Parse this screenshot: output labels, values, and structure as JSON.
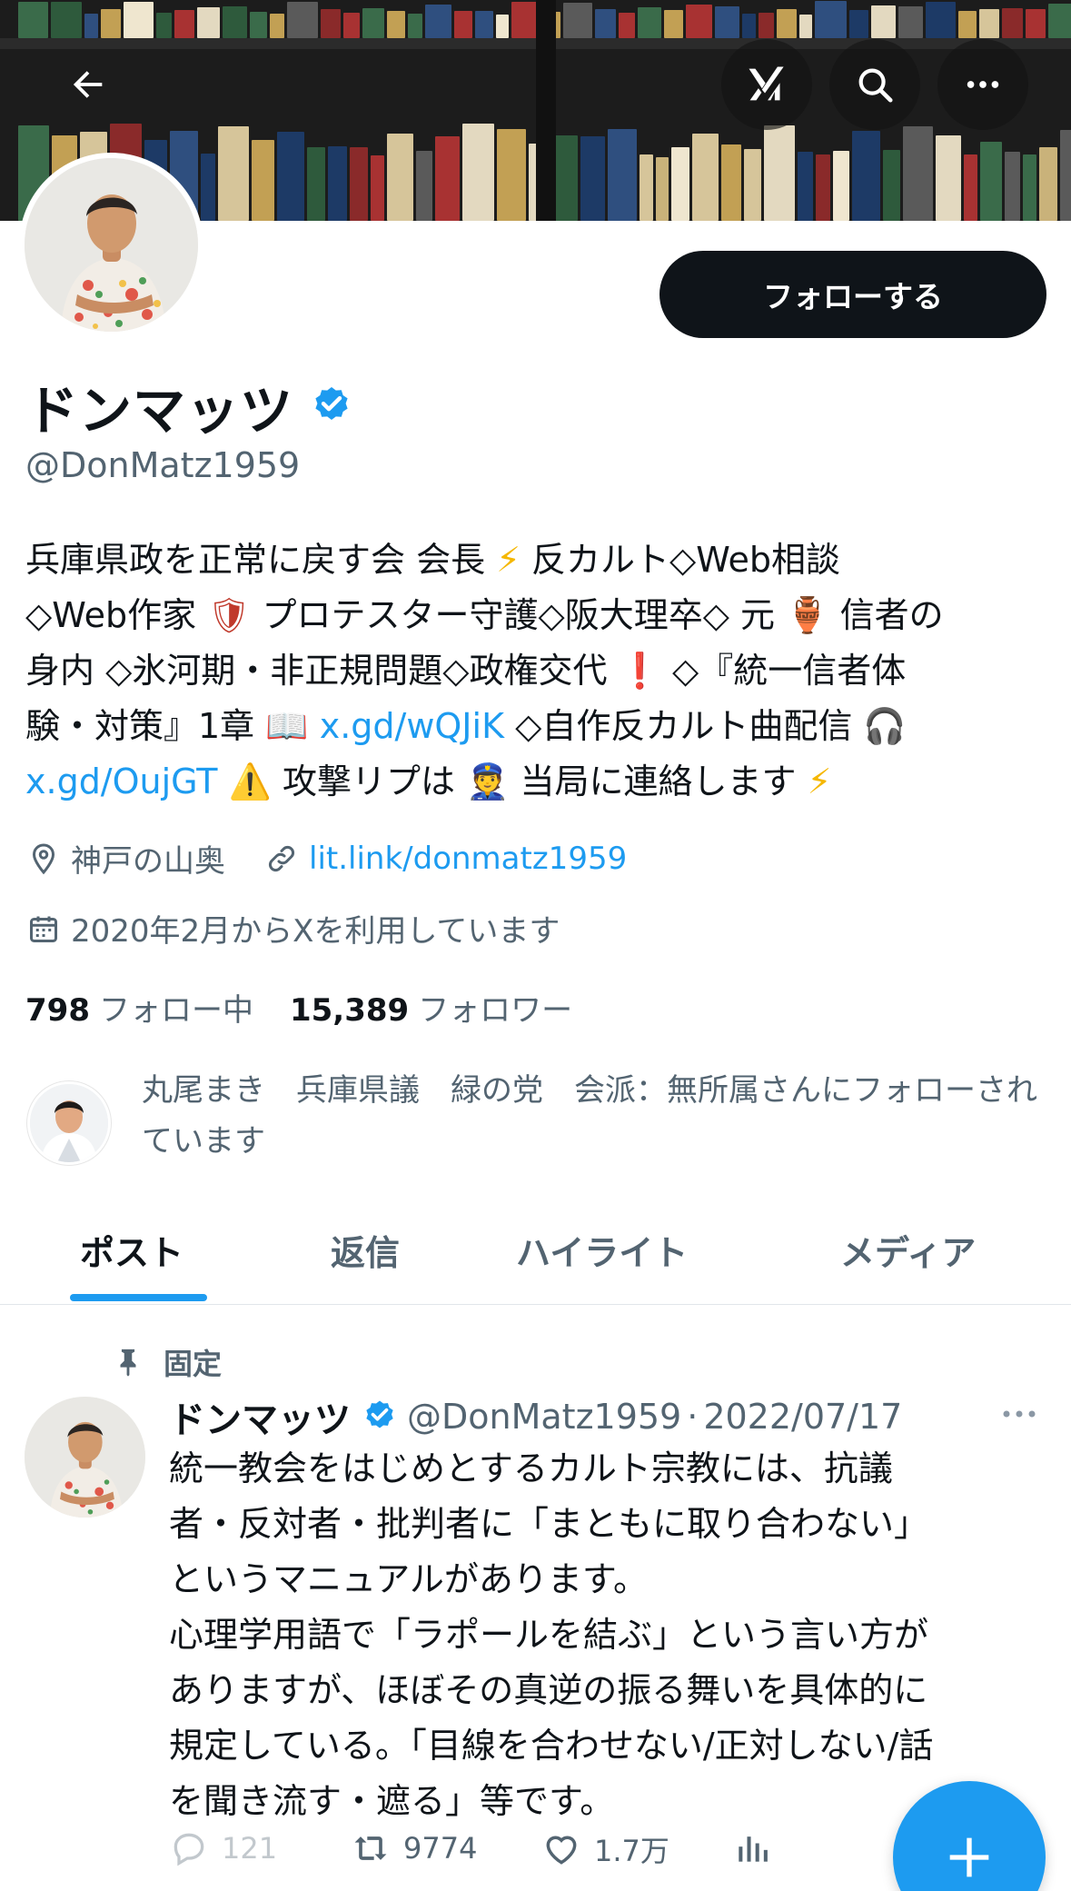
{
  "banner": {
    "colors": [
      "#c9b27a",
      "#8a2a2a",
      "#2f4f7f",
      "#e3d9c0",
      "#3a6b4a",
      "#d6c59a",
      "#1d3a66",
      "#a83232",
      "#efe6cf",
      "#5a5a5a",
      "#c2a054",
      "#2e5a3c"
    ]
  },
  "nav": {
    "back_icon": "arrow-left-icon",
    "grok_icon": "grok-icon",
    "search_icon": "search-icon",
    "more_icon": "more-horizontal-icon"
  },
  "profile": {
    "name": "ドンマッツ",
    "handle": "@DonMatz1959",
    "follow_label": "フォローする",
    "verified_color": "#1d9bf0",
    "bio": {
      "l1a": "兵庫県政を正常に戻す会 会長",
      "l1b": "反カルト◇Web相談",
      "l2a": "◇Web作家",
      "l2b": "プロテスター守護◇阪大理卒◇ 元",
      "l2c": "信者の",
      "l3a": "身内 ◇氷河期・非正規問題◇政権交代",
      "l3b": "◇『統一信者体",
      "l4a": "験・対策』1章",
      "l4link": "x.gd/wQJiK",
      "l4b": "◇自作反カルト曲配信",
      "l5link": "x.gd/OujGT",
      "l5a": "攻撃リプは",
      "l5b": "当局に連絡します",
      "emoji_bolt": "⚡",
      "emoji_shield": "🛡",
      "emoji_amphora": "🏺",
      "emoji_exclaim": "❗",
      "emoji_book": "📖",
      "emoji_headphones": "🎧",
      "emoji_warning": "⚠️",
      "emoji_police": "👮"
    },
    "location": "神戸の山奥",
    "website": "lit.link/donmatz1959",
    "joined": "2020年2月からXを利用しています",
    "following_count": "798",
    "following_label": "フォロー中",
    "followers_count": "15,389",
    "followers_label": "フォロワー",
    "followed_by_text": "丸尾まき　兵庫県議　緑の党　会派：無所属さんにフォローされています"
  },
  "tabs": [
    {
      "label": "ポスト",
      "active": true
    },
    {
      "label": "返信",
      "active": false
    },
    {
      "label": "ハイライト",
      "active": false
    },
    {
      "label": "メディア",
      "active": false
    }
  ],
  "post": {
    "pinned_label": "固定",
    "name": "ドンマッツ",
    "handle": "@DonMatz1959",
    "date": "2022/07/17",
    "separator": "·",
    "lines": [
      "統一教会をはじめとするカルト宗教には、抗議",
      "者・反対者・批判者に「まともに取り合わない」",
      "というマニュアルがあります。",
      "心理学用語で「ラポールを結ぶ」という言い方が",
      "ありますが、ほぼその真逆の振る舞いを具体的に",
      "規定している。「目線を合わせない/正対しない/話",
      "を聞き流す・遮る」等です。"
    ],
    "replies": "121",
    "reposts": "9774",
    "likes": "1.7万"
  },
  "fab": {
    "icon": "plus-icon"
  }
}
